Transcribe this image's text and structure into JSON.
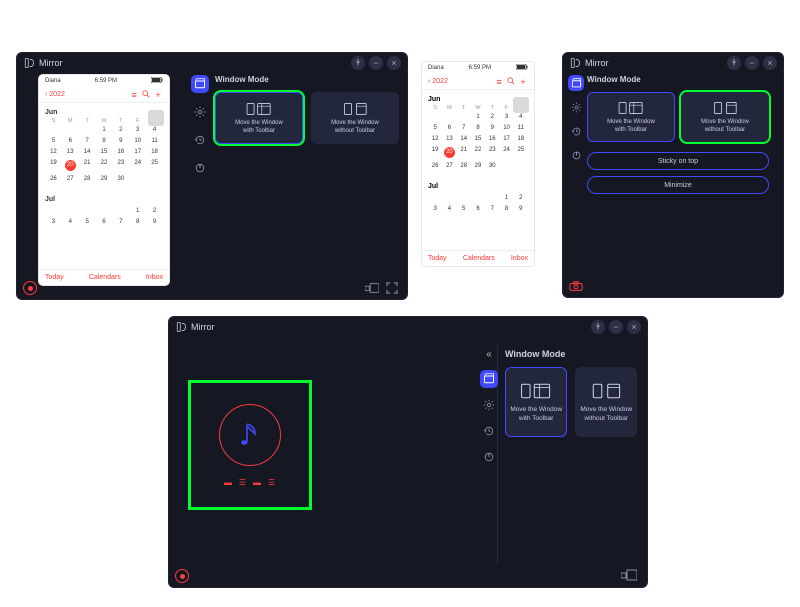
{
  "colors": {
    "accent": "#4049ff",
    "highlight": "#00ff2f",
    "danger": "#ff3b3b",
    "bg_dark": "#151823",
    "card": "#22273c"
  },
  "app_title": "Mirror",
  "phone": {
    "carrier": "Diana",
    "time": "6:59 PM",
    "back_year": "2022",
    "month1": "Jun",
    "month2": "Jul",
    "today": "20",
    "day_headers": [
      "S",
      "M",
      "T",
      "W",
      "T",
      "F",
      "S"
    ],
    "jun_cells": [
      "",
      "",
      "",
      "1",
      "2",
      "3",
      "4",
      "5",
      "6",
      "7",
      "8",
      "9",
      "10",
      "11",
      "12",
      "13",
      "14",
      "15",
      "16",
      "17",
      "18",
      "19",
      "20",
      "21",
      "22",
      "23",
      "24",
      "25",
      "26",
      "27",
      "28",
      "29",
      "30",
      "",
      "",
      ""
    ],
    "jul_cells": [
      "",
      "",
      "",
      "",
      "",
      "1",
      "2",
      "3",
      "4",
      "5",
      "6",
      "7",
      "8",
      "9"
    ],
    "footer": {
      "today": "Today",
      "calendars": "Calendars",
      "inbox": "Inbox"
    }
  },
  "section_title": "Window Mode",
  "modes": {
    "with_toolbar_line1": "Move the Window",
    "with_toolbar_line2": "with Toolbar",
    "without_toolbar_line1": "Move the Window",
    "without_toolbar_line2": "without Toolbar"
  },
  "win2": {
    "sticky_btn": "Sticky on top",
    "minimize_btn": "Minimize"
  },
  "icons": {
    "window_mode": "window-mode",
    "settings": "gear",
    "history": "history",
    "power": "power",
    "search": "search",
    "plus": "plus",
    "list": "list",
    "fullscreen": "fullscreen",
    "collapse": "chevrons-left",
    "sources": "sources",
    "camera": "camera"
  }
}
